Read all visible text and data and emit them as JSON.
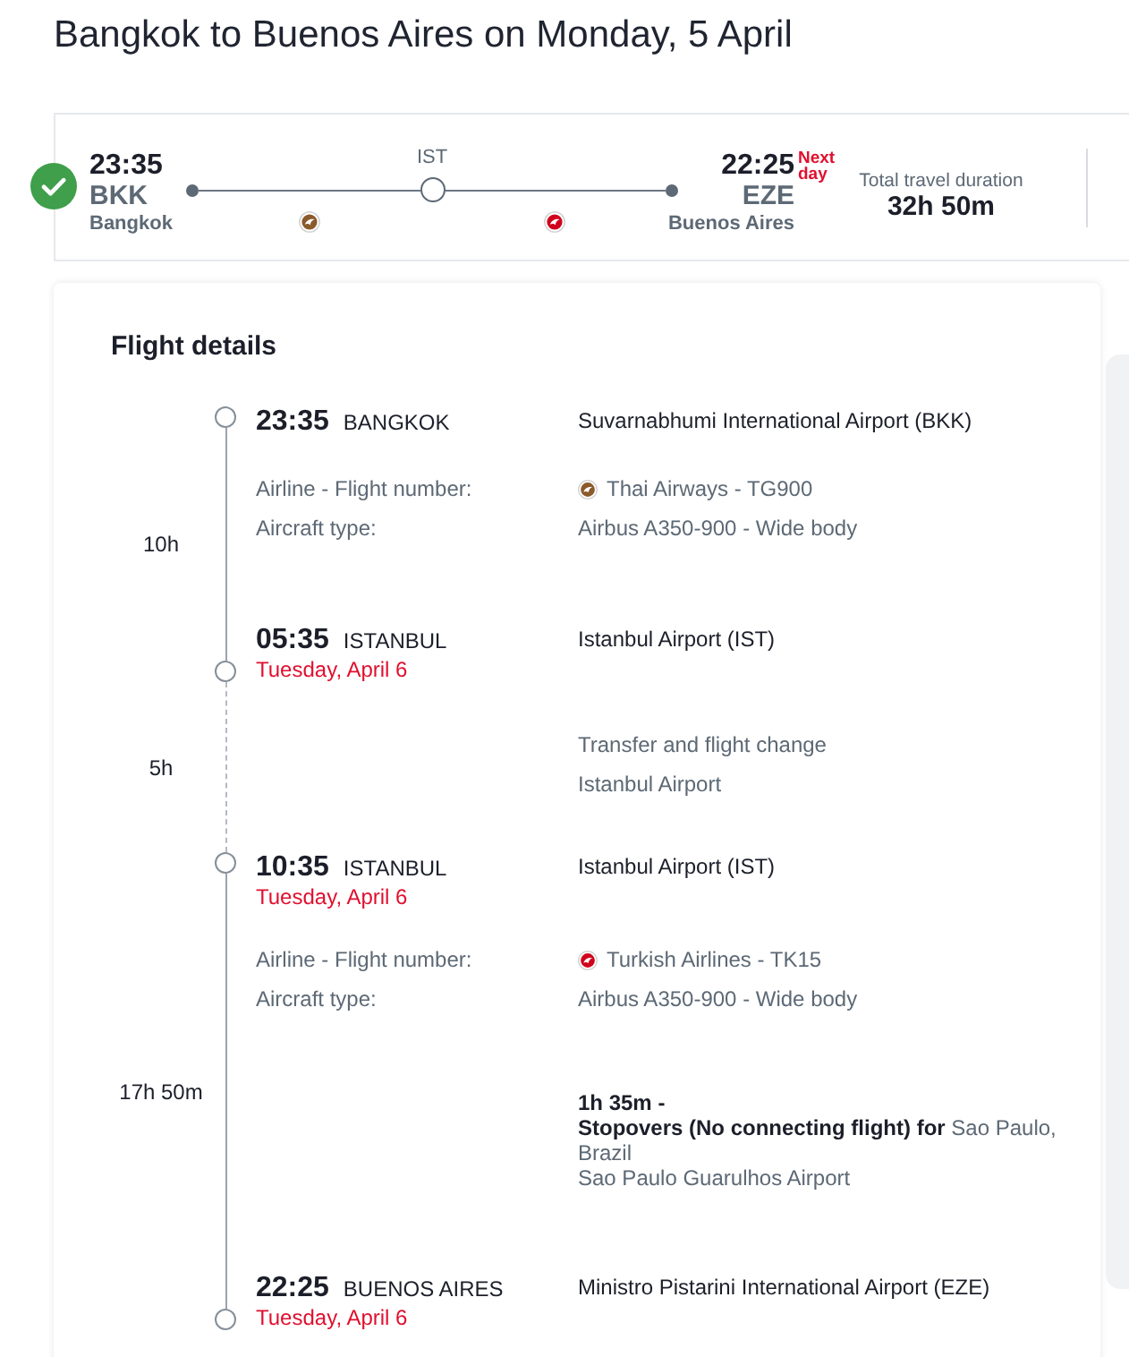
{
  "page_title": "Bangkok to Buenos Aires on Monday, 5 April",
  "summary": {
    "departure": {
      "time": "23:35",
      "code": "BKK",
      "city": "Bangkok"
    },
    "route": {
      "legs": [
        {
          "color": "#8b5a2b"
        },
        {
          "color": "#d0021b"
        }
      ],
      "stops": [
        {
          "code": "IST"
        }
      ]
    },
    "arrival": {
      "time": "22:25",
      "note": "Next day",
      "code": "EZE",
      "city": "Buenos Aires"
    },
    "total_label": "Total travel duration",
    "total": "32h 50m"
  },
  "details": {
    "title": "Flight details",
    "timeline": [
      {
        "kind": "departure",
        "time": "23:35",
        "city": "BANGKOK",
        "airport": "Suvarnabhumi International Airport (BKK)"
      },
      {
        "kind": "flight",
        "duration": "10h",
        "airline_label": "Airline - Flight number:",
        "airline": {
          "name": "Thai Airways - TG900",
          "color": "#8b5a2b"
        },
        "aircraft_label": "Aircraft type:",
        "aircraft": "Airbus A350-900 - Wide body"
      },
      {
        "kind": "arrival",
        "time": "05:35",
        "city": "ISTANBUL",
        "date": "Tuesday, April 6",
        "airport": "Istanbul Airport (IST)"
      },
      {
        "kind": "transfer",
        "duration": "5h",
        "lines": [
          "Transfer and flight change",
          "Istanbul Airport"
        ]
      },
      {
        "kind": "departure",
        "time": "10:35",
        "city": "ISTANBUL",
        "date": "Tuesday, April 6",
        "airport": "Istanbul Airport (IST)"
      },
      {
        "kind": "flight",
        "duration": "17h 50m",
        "airline_label": "Airline - Flight number:",
        "airline": {
          "name": "Turkish Airlines - TK15",
          "color": "#d0021b"
        },
        "aircraft_label": "Aircraft type:",
        "aircraft": "Airbus A350-900 - Wide body",
        "stopover": {
          "duration": "1h 35m -",
          "text": "**Stopovers (No connecting flight) for** Sao Paulo, Brazil",
          "airport": "Sao Paulo Guarulhos Airport"
        }
      },
      {
        "kind": "arrival",
        "time": "22:25",
        "city": "BUENOS AIRES",
        "date": "Tuesday, April 6",
        "airport": "Ministro Pistarini International Airport (EZE)"
      }
    ]
  }
}
